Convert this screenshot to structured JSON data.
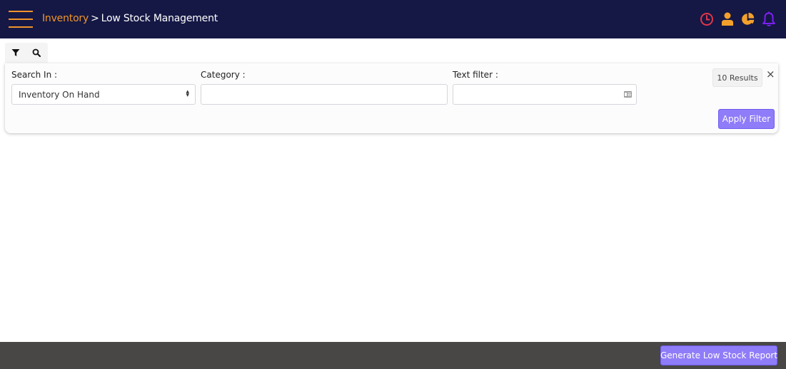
{
  "header": {
    "breadcrumb": {
      "parent": "Inventory",
      "separator": ">",
      "current": "Low Stock Management"
    },
    "icons": [
      {
        "name": "clock-icon",
        "color": "#e0364a"
      },
      {
        "name": "user-icon",
        "color": "#f4a12c"
      },
      {
        "name": "pie-chart-icon",
        "color": "#f4a12c"
      },
      {
        "name": "bell-icon",
        "color": "#7b1ff0"
      }
    ],
    "accent_color": "#f0952a",
    "background_color": "#151845"
  },
  "toolbar": {
    "tabs": [
      {
        "name": "filter-icon",
        "active": true
      },
      {
        "name": "search-icon",
        "active": false
      }
    ]
  },
  "filter_panel": {
    "search_in": {
      "label": "Search In :",
      "selected": "Inventory On Hand"
    },
    "category": {
      "label": "Category :",
      "value": ""
    },
    "text_filter": {
      "label": "Text filter :",
      "value": ""
    },
    "results_count": "10 Results",
    "close_label": "×",
    "apply_label": "Apply Filter"
  },
  "footer": {
    "report_button_label": "Generate Low Stock Report",
    "button_color": "#8f7cf8"
  }
}
